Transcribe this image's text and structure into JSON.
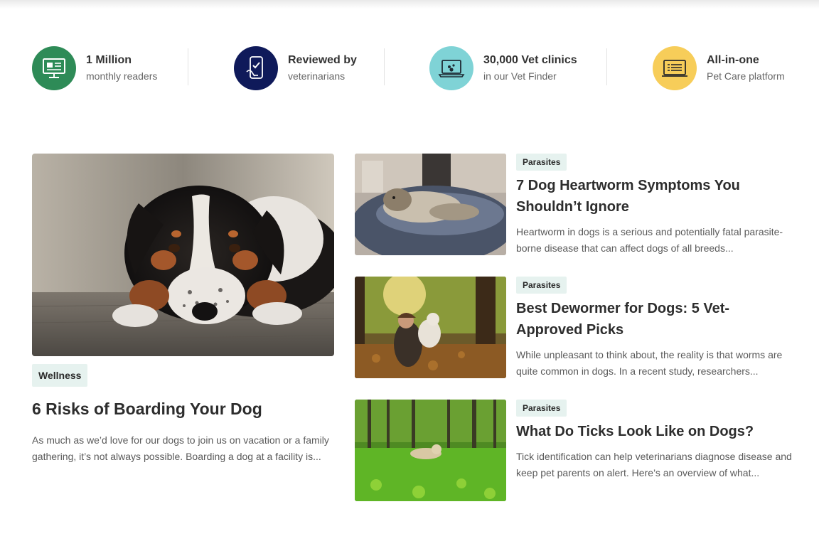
{
  "stats": [
    {
      "title": "1 Million",
      "subtitle": "monthly readers",
      "icon": "monitor-chart-icon",
      "color": "#2e8b57"
    },
    {
      "title": "Reviewed by",
      "subtitle": "veterinarians",
      "icon": "phone-check-icon",
      "color": "#0f1a5a"
    },
    {
      "title": "30,000 Vet clinics",
      "subtitle": "in our Vet Finder",
      "icon": "laptop-pet-icon",
      "color": "#7fd3d6"
    },
    {
      "title": "All-in-one",
      "subtitle": "Pet Care platform",
      "icon": "document-list-icon",
      "color": "#f7cd59"
    }
  ],
  "featured": {
    "tag": "Wellness",
    "title": "6 Risks of Boarding Your Dog",
    "excerpt": "As much as we’d love for our dogs to join us on vacation or a family gathering, it’s not always possible. Boarding a dog at a facility is..."
  },
  "articles": [
    {
      "tag": "Parasites",
      "title": "7 Dog Heartworm Symptoms You Shouldn’t Ignore",
      "excerpt": "Heartworm in dogs is a serious and potentially fatal parasite-borne disease that can affect dogs of all breeds..."
    },
    {
      "tag": "Parasites",
      "title": "Best Dewormer for Dogs: 5 Vet-Approved Picks",
      "excerpt": "While unpleasant to think about, the reality is that worms are quite common in dogs. In a recent study, researchers..."
    },
    {
      "tag": "Parasites",
      "title": "What Do Ticks Look Like on Dogs?",
      "excerpt": "Tick identification can help veterinarians diagnose disease and keep pet parents on alert. Here’s an overview of what..."
    }
  ]
}
